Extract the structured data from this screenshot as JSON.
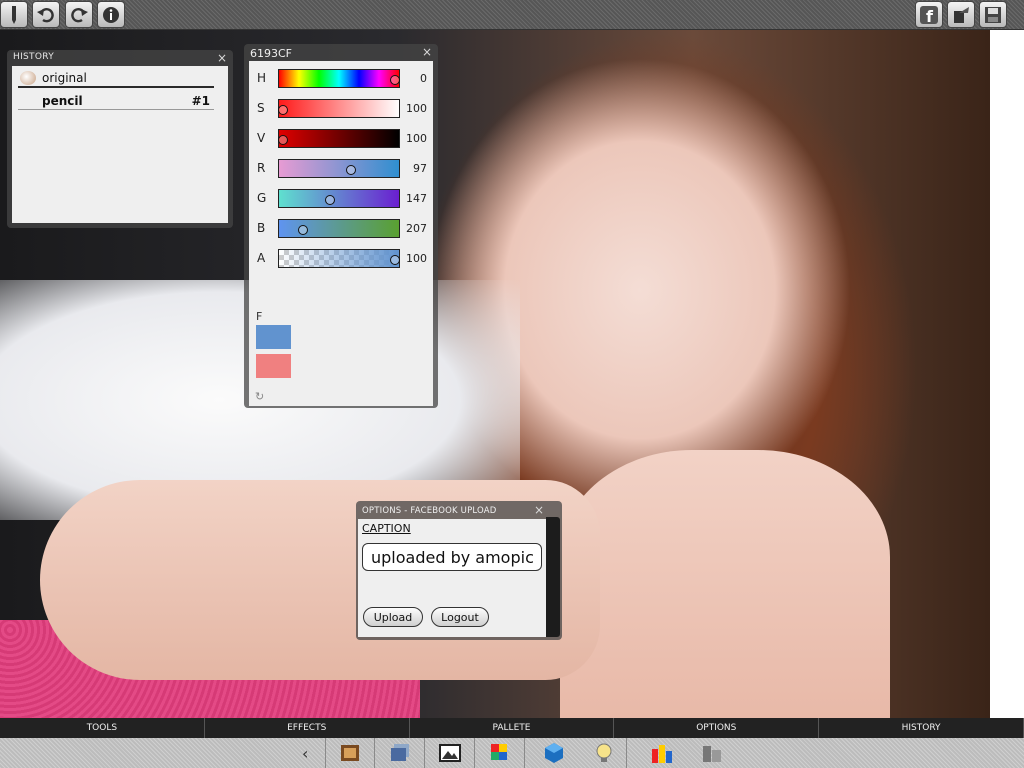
{
  "toolbar": {
    "icons": [
      "pencil-icon",
      "undo-icon",
      "redo-icon",
      "info-icon",
      "facebook-icon",
      "export-icon",
      "save-icon"
    ],
    "facebook_letter": "f"
  },
  "history": {
    "title": "HISTORY",
    "close": "×",
    "items": [
      {
        "label": "original",
        "num": ""
      },
      {
        "label": "pencil",
        "num": "#1"
      }
    ]
  },
  "color": {
    "hex": "6193CF",
    "close": "×",
    "sliders": [
      {
        "ch": "H",
        "val": "0",
        "level": 1.0
      },
      {
        "ch": "S",
        "val": "100",
        "level": 0.0
      },
      {
        "ch": "V",
        "val": "100",
        "level": 0.0
      },
      {
        "ch": "R",
        "val": "97",
        "level": 0.61
      },
      {
        "ch": "G",
        "val": "147",
        "level": 0.42
      },
      {
        "ch": "B",
        "val": "207",
        "level": 0.18
      },
      {
        "ch": "A",
        "val": "100",
        "level": 1.0
      }
    ],
    "f_label": "F",
    "fg_color": "#6193cf",
    "bg_color": "#f08080"
  },
  "options": {
    "title": "OPTIONS - FACEBOOK UPLOAD",
    "close": "×",
    "caption_label": "CAPTION",
    "caption_value": "uploaded by amopic",
    "upload_label": "Upload",
    "logout_label": "Logout"
  },
  "tabs": [
    "TOOLS",
    "EFFECTS",
    "PALLETE",
    "OPTIONS",
    "HISTORY"
  ],
  "dock": {
    "arrow": "‹",
    "icons": [
      "photo-frame-icon",
      "image-stack-icon",
      "landscape-icon",
      "palette-icon",
      "cube-icon",
      "lightbulb-icon",
      "color-bars-icon",
      "gray-blocks-icon"
    ]
  }
}
